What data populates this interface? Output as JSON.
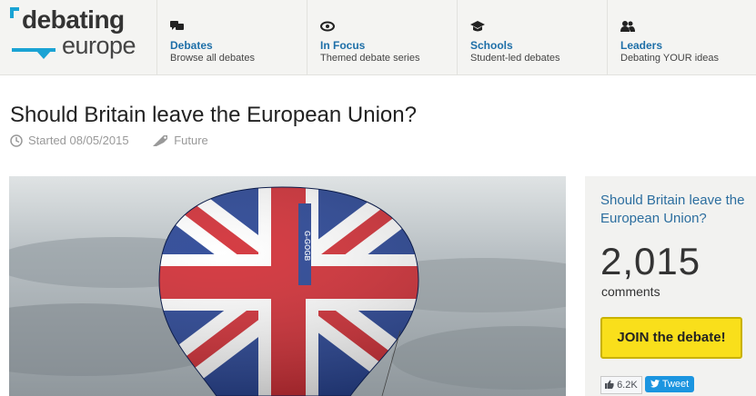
{
  "logo": {
    "line1": "debating",
    "line2": "europe"
  },
  "nav": [
    {
      "title": "Debates",
      "subtitle": "Browse all debates",
      "icon": "speech-bubbles-icon"
    },
    {
      "title": "In Focus",
      "subtitle": "Themed debate series",
      "icon": "eye-icon"
    },
    {
      "title": "Schools",
      "subtitle": "Student-led debates",
      "icon": "graduation-cap-icon"
    },
    {
      "title": "Leaders",
      "subtitle": "Debating YOUR ideas",
      "icon": "people-icon"
    }
  ],
  "article": {
    "title": "Should Britain leave the European Union?",
    "started": "Started 08/05/2015",
    "tag": "Future"
  },
  "hero": {
    "balloon_text": "G-GOGB"
  },
  "sidebar": {
    "question": "Should Britain leave the European Union?",
    "comment_count": "2,015",
    "comment_label": "comments",
    "join_label": "JOIN the debate!",
    "like_count": "6.2K",
    "tweet_label": "Tweet"
  },
  "colors": {
    "brand_blue": "#1aa3d4",
    "link_blue": "#1e6fa8",
    "join_yellow": "#f9df1b"
  }
}
